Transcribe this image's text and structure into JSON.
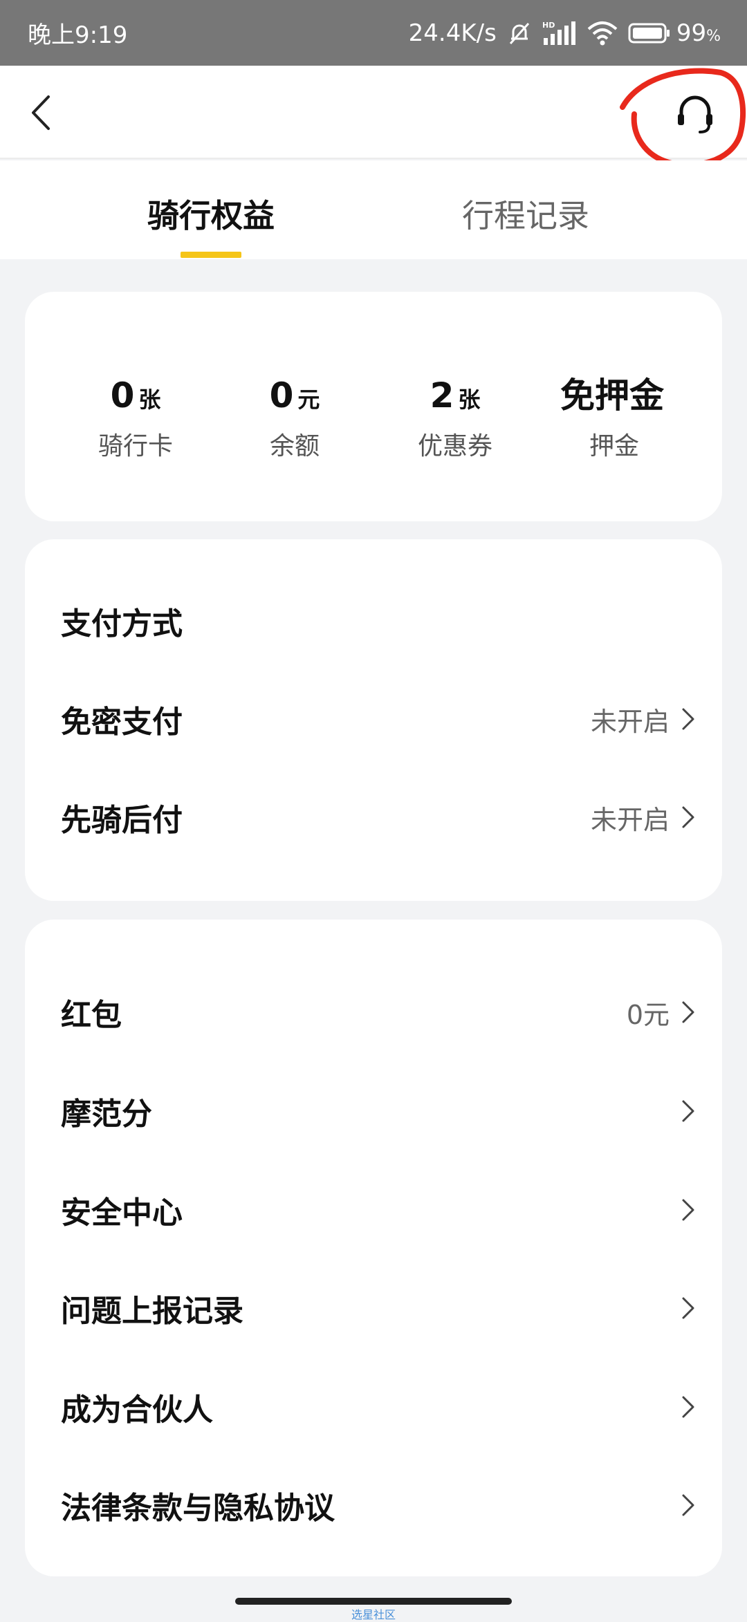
{
  "status_bar": {
    "time": "晚上9:19",
    "network_speed": "24.4K/s",
    "battery": "99",
    "battery_unit": "%",
    "icons": [
      "mute-bell-icon",
      "hd-signal-icon",
      "wifi-icon",
      "battery-icon"
    ]
  },
  "nav": {
    "back_icon": "back-arrow-icon",
    "support_icon": "headset-icon",
    "annotation_color": "#e8291c"
  },
  "tabs": [
    {
      "label": "骑行权益",
      "active": true
    },
    {
      "label": "行程记录",
      "active": false
    }
  ],
  "accent_color": "#f5c518",
  "stats": [
    {
      "value": "0",
      "unit": "张",
      "label": "骑行卡"
    },
    {
      "value": "0",
      "unit": "元",
      "label": "余额"
    },
    {
      "value": "2",
      "unit": "张",
      "label": "优惠券"
    },
    {
      "value": "免押金",
      "unit": "",
      "label": "押金"
    }
  ],
  "payment": {
    "title": "支付方式",
    "items": [
      {
        "label": "免密支付",
        "value": "未开启"
      },
      {
        "label": "先骑后付",
        "value": "未开启"
      }
    ]
  },
  "menu": [
    {
      "label": "红包",
      "value": "0元"
    },
    {
      "label": "摩范分",
      "value": ""
    },
    {
      "label": "安全中心",
      "value": ""
    },
    {
      "label": "问题上报记录",
      "value": ""
    },
    {
      "label": "成为合伙人",
      "value": ""
    },
    {
      "label": "法律条款与隐私协议",
      "value": ""
    }
  ],
  "watermark": "选星社区"
}
